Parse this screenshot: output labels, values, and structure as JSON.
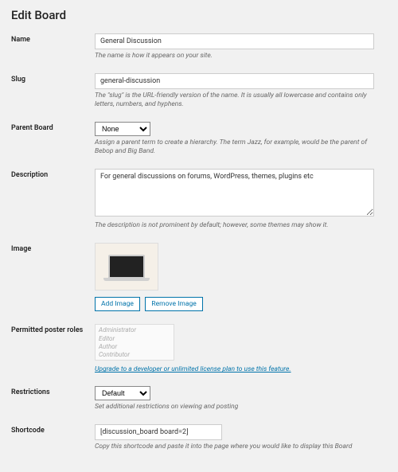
{
  "page_title": "Edit Board",
  "fields": {
    "name": {
      "label": "Name",
      "value": "General Discussion",
      "hint": "The name is how it appears on your site."
    },
    "slug": {
      "label": "Slug",
      "value": "general-discussion",
      "hint": "The \"slug\" is the URL-friendly version of the name. It is usually all lowercase and contains only letters, numbers, and hyphens."
    },
    "parent": {
      "label": "Parent Board",
      "selected": "None",
      "hint": "Assign a parent term to create a hierarchy. The term Jazz, for example, would be the parent of Bebop and Big Band."
    },
    "description": {
      "label": "Description",
      "value": "For general discussions on forums, WordPress, themes, plugins etc",
      "hint": "The description is not prominent by default; however, some themes may show it."
    },
    "image": {
      "label": "Image",
      "add_label": "Add Image",
      "remove_label": "Remove Image"
    },
    "roles": {
      "label": "Permitted poster roles",
      "options": [
        "Administrator",
        "Editor",
        "Author",
        "Contributor"
      ],
      "upsell": "Upgrade to a developer or unlimited license plan to use this feature."
    },
    "restrictions": {
      "label": "Restrictions",
      "selected": "Default",
      "hint": "Set additional restrictions on viewing and posting"
    },
    "shortcode": {
      "label": "Shortcode",
      "value": "[discussion_board board=2]",
      "hint": "Copy this shortcode and paste it into the page where you would like to display this Board"
    }
  }
}
